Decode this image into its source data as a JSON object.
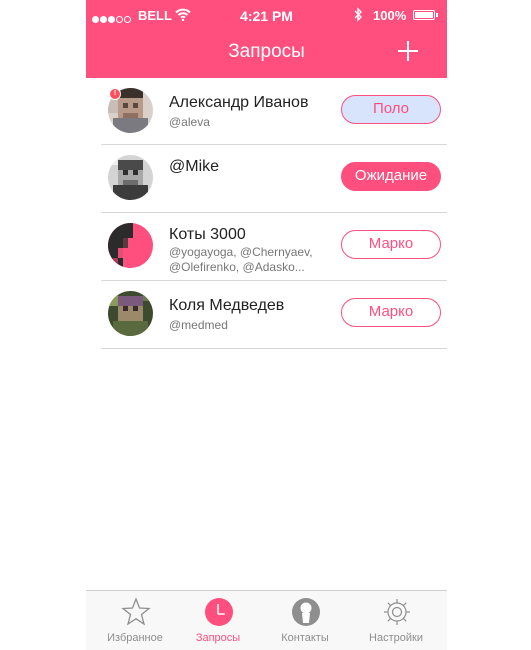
{
  "status_bar": {
    "carrier": "BELL",
    "time": "4:21 PM",
    "battery": "100%",
    "signal_filled": 3,
    "signal_total": 5
  },
  "header": {
    "title": "Запросы",
    "add_icon": "plus-icon"
  },
  "requests": [
    {
      "name": "Александр Иванов",
      "sub": "@aleva",
      "button": "Поло",
      "button_style": "polo",
      "badge": "!"
    },
    {
      "name": "@Mike",
      "sub": "",
      "button": "Ожидание",
      "button_style": "wait"
    },
    {
      "name": "Коты 3000",
      "sub": "@yogayoga, @Chernyaev, @Olefirenko, @Adasko...",
      "button": "Марко",
      "button_style": "outline"
    },
    {
      "name": "Коля Медведев",
      "sub": "@medmed",
      "button": "Марко",
      "button_style": "outline"
    }
  ],
  "tabs": [
    {
      "label": "Избранное",
      "icon": "star-icon",
      "active": false
    },
    {
      "label": "Запросы",
      "icon": "clock-icon",
      "active": true
    },
    {
      "label": "Контакты",
      "icon": "contact-icon",
      "active": false
    },
    {
      "label": "Настройки",
      "icon": "gear-icon",
      "active": false
    }
  ],
  "colors": {
    "accent": "#ff4f7e",
    "polo_bg": "#d7e4fb",
    "tab_inactive": "#8e8e8e"
  }
}
